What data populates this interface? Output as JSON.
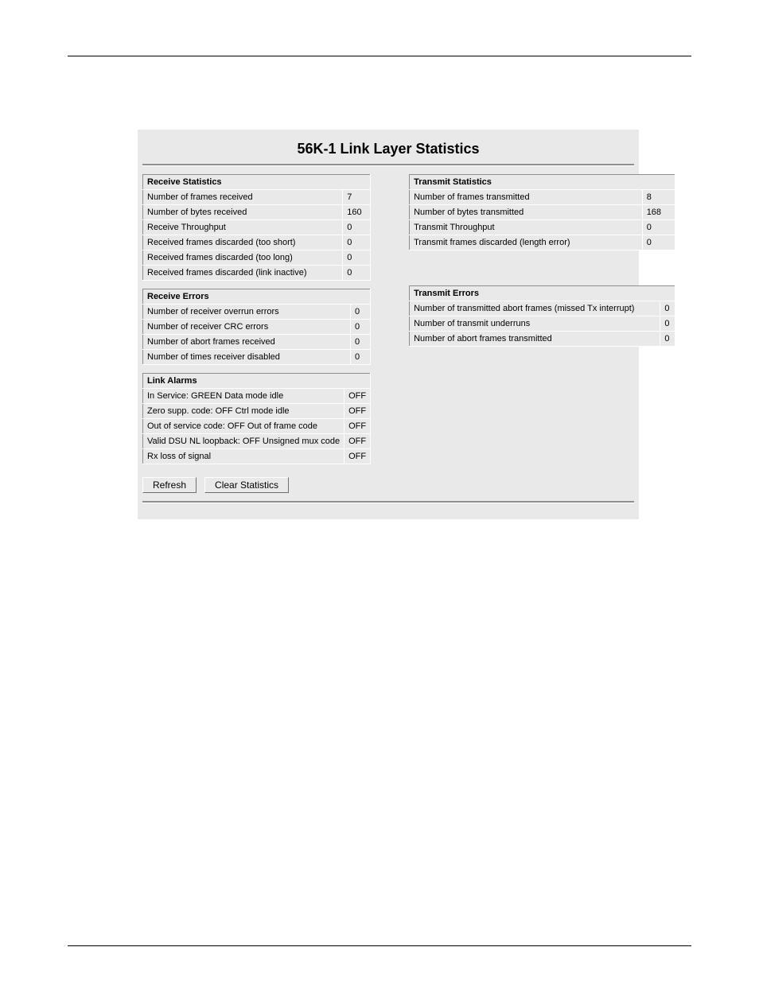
{
  "title": "56K-1 Link Layer Statistics",
  "receive_stats": {
    "header": "Receive Statistics",
    "rows": [
      {
        "label": "Number of frames received",
        "value": "7"
      },
      {
        "label": "Number of bytes received",
        "value": "160"
      },
      {
        "label": "Receive Throughput",
        "value": "0"
      },
      {
        "label": "Received frames discarded (too short)",
        "value": "0"
      },
      {
        "label": "Received frames discarded (too long)",
        "value": "0"
      },
      {
        "label": "Received frames discarded (link inactive)",
        "value": "0"
      }
    ]
  },
  "receive_errors": {
    "header": "Receive Errors",
    "rows": [
      {
        "label": "Number of receiver overrun errors",
        "value": "0"
      },
      {
        "label": "Number of receiver CRC errors",
        "value": "0"
      },
      {
        "label": "Number of abort frames received",
        "value": "0"
      },
      {
        "label": "Number of times receiver disabled",
        "value": "0"
      }
    ]
  },
  "link_alarms": {
    "header": "Link Alarms",
    "rows": [
      {
        "label": "In Service: GREEN Data mode idle",
        "value": "OFF"
      },
      {
        "label": "Zero supp. code: OFF Ctrl mode idle",
        "value": "OFF"
      },
      {
        "label": "Out of service code: OFF Out of frame code",
        "value": "OFF"
      },
      {
        "label": "Valid DSU NL loopback: OFF Unsigned mux code",
        "value": "OFF"
      },
      {
        "label": "Rx loss of signal",
        "value": "OFF"
      }
    ]
  },
  "transmit_stats": {
    "header": "Transmit Statistics",
    "rows": [
      {
        "label": "Number of frames transmitted",
        "value": "8"
      },
      {
        "label": "Number of bytes transmitted",
        "value": "168"
      },
      {
        "label": "Transmit Throughput",
        "value": "0"
      },
      {
        "label": "Transmit frames discarded (length error)",
        "value": "0"
      }
    ]
  },
  "transmit_errors": {
    "header": "Transmit Errors",
    "rows": [
      {
        "label": "Number of transmitted abort frames (missed Tx interrupt)",
        "value": "0"
      },
      {
        "label": "Number of transmit underruns",
        "value": "0"
      },
      {
        "label": "Number of abort frames transmitted",
        "value": "0"
      }
    ]
  },
  "buttons": {
    "refresh": "Refresh",
    "clear": "Clear Statistics"
  }
}
